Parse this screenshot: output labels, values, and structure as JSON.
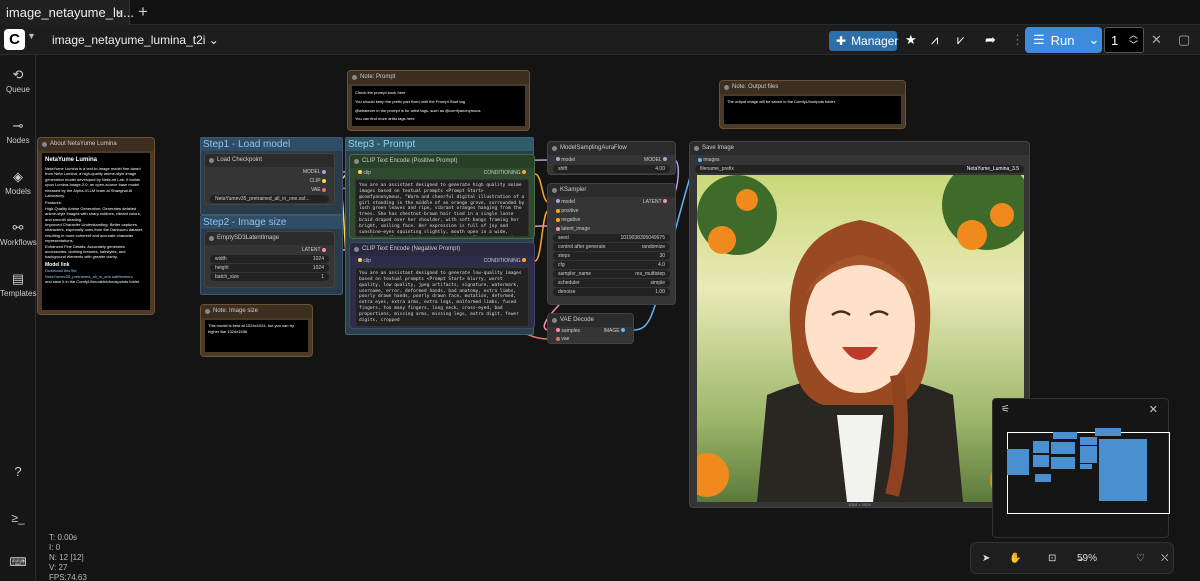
{
  "tabs": [
    {
      "label": "image_netayume_lu...",
      "close": "×"
    }
  ],
  "new_tab": "+",
  "toolbar": {
    "logo": "C",
    "workflow_name": "image_netayume_lumina_t2i",
    "workflow_caret": "⌄",
    "manager_label": "Manager",
    "run_label": "Run",
    "run_count": "1"
  },
  "sidebar": [
    {
      "icon": "queue-icon",
      "glyph": "⟲",
      "label": "Queue"
    },
    {
      "icon": "nodes-icon",
      "glyph": "⊸",
      "label": "Nodes"
    },
    {
      "icon": "models-icon",
      "glyph": "◈",
      "label": "Models"
    },
    {
      "icon": "workflows-icon",
      "glyph": "⚯",
      "label": "Workflows"
    },
    {
      "icon": "templates-icon",
      "glyph": "▤",
      "label": "Templates"
    }
  ],
  "groups": {
    "step1": "Step1 - Load model",
    "step2": "Step2 - Image size",
    "step3": "Step3 - Prompt"
  },
  "notes": {
    "about": {
      "title": "About NetaYume Lumina",
      "heading": "NetaYume Lumina",
      "body": "NetaYume Lumina is a text-to-image model fine-tuned from Neta Lumina, a high-quality anime-style image generation model developed by Neta.art Lab. It builds upon Lumina-Image-2.0, an open-source base model released by the Alpha-VLLM team at Shanghai AI Laboratory.",
      "features_label": "Features:",
      "f1": "High-Quality Anime Generation: Generates detailed anime-style images with sharp outlines, vibrant colors, and smooth shading.",
      "f2": "Improved Character Understanding: Better captures characters, especially ones from the Danbooru dataset, resulting in more coherent and accurate character representations.",
      "f3": "Enhanced Fine Details: Accurately generates accessories, clothing textures, hairstyles, and background elements with greater clarity.",
      "link_heading": "Model link",
      "link1": "Download this file: NetaYumev35_pretrained_all_in_one.safetensors",
      "link2": "and save it in the ComfyUI/models/checkpoints folder."
    },
    "prompt": {
      "title": "Note: Prompt",
      "l1": "Check the prompt book here",
      "l2": "You should keep the prefix part fixed until the Prompt Start tag",
      "l3": "@whatever in the prompt is for artist tags, such as @comfyanonymous",
      "l4": "You can find more artist tags here"
    },
    "output": {
      "title": "Note: Output files",
      "body": "The output image will be saved in the ComfyUI/outputs folder."
    },
    "image_size": {
      "title": "Note: Image size",
      "body": "This model is best at 1024x1024, but you can try higher like 1024x1536"
    }
  },
  "nodes": {
    "load_checkpoint": {
      "title": "Load Checkpoint",
      "out_model": "MODEL",
      "out_clip": "CLIP",
      "out_vae": "VAE",
      "ckpt": "NetaYumev35_pretrained_all_in_one.saf..."
    },
    "empty_latent": {
      "title": "EmptySD3LatentImage",
      "out": "LATENT",
      "width_label": "width",
      "width": "1024",
      "height_label": "height",
      "height": "1024",
      "batch_label": "batch_size",
      "batch": "1"
    },
    "clip_pos": {
      "title": "CLIP Text Encode (Positive Prompt)",
      "in": "clip",
      "out": "CONDITIONING",
      "text": "You are an assistant designed to generate high quality anime images based on textual prompts <Prompt Start> @comfyanonymous, \"Warm and cheerful digital illustration of a girl standing in the middle of an orange grove, surrounded by lush green leaves and ripe, vibrant oranges hanging from the trees. She has chestnut-brown hair tied in a single loose braid draped over her shoulder, with soft bangs framing her bright, smiling face. Her expression is full of joy and sunshine—eyes squinting slightly, mouth open in a wide, carefree smile, radiating pure happiness. She wears a crisp white blouse underneath a black jacket, slightly unbuttoned for a relaxed look. The sunlight"
    },
    "clip_neg": {
      "title": "CLIP Text Encode (Negative Prompt)",
      "in": "clip",
      "out": "CONDITIONING",
      "text": "You are an assistant designed to generate low-quality images based on textual prompts <Prompt Start> blurry, worst quality, low quality, jpeg artifacts, signature, watermark, username, error, deformed hands, bad anatomy, extra limbs, poorly drawn hands, poorly drawn face, mutation, deformed, extra eyes, extra arms, extra legs, malformed limbs, fused fingers, too many fingers, long neck, cross-eyed, bad proportions, missing arms, missing legs, extra digit, fewer digits, cropped"
    },
    "model_sampling": {
      "title": "ModelSamplingAuraFlow",
      "in": "model",
      "out": "MODEL",
      "shift_label": "shift",
      "shift": "4.00"
    },
    "ksampler": {
      "title": "KSampler",
      "in_model": "model",
      "in_pos": "positive",
      "in_neg": "negative",
      "in_latent": "latent_image",
      "out": "LATENT",
      "seed_label": "seed",
      "seed": "1019038305049975",
      "cag_label": "control after generate",
      "cag": "randomize",
      "steps_label": "steps",
      "steps": "30",
      "cfg_label": "cfg",
      "cfg": "4.0",
      "sampler_label": "sampler_name",
      "sampler": "res_multistep",
      "sched_label": "scheduler",
      "sched": "simple",
      "denoise_label": "denoise",
      "denoise": "1.00"
    },
    "vae_decode": {
      "title": "VAE Decode",
      "in_samples": "samples",
      "in_vae": "vae",
      "out": "IMAGE"
    },
    "save_image": {
      "title": "Save Image",
      "in": "images",
      "prefix_label": "filename_prefix",
      "prefix": "NetaYume_Lumina_3.5",
      "size": "1024 × 1024"
    }
  },
  "stats": {
    "t": "T: 0.00s",
    "i": "I: 0",
    "n": "N: 12 [12]",
    "v": "V: 27",
    "fps": "FPS:74.63"
  },
  "bottombar": {
    "zoom": "59%"
  },
  "colors": {
    "accent": "#3d8bdc",
    "manager": "#2d6ea8",
    "clip_pos_bg": "#2f4a2f",
    "clip_neg_bg": "#2e2e4a",
    "group_blue": "#304d66",
    "group_teal": "#2f5b6b"
  }
}
